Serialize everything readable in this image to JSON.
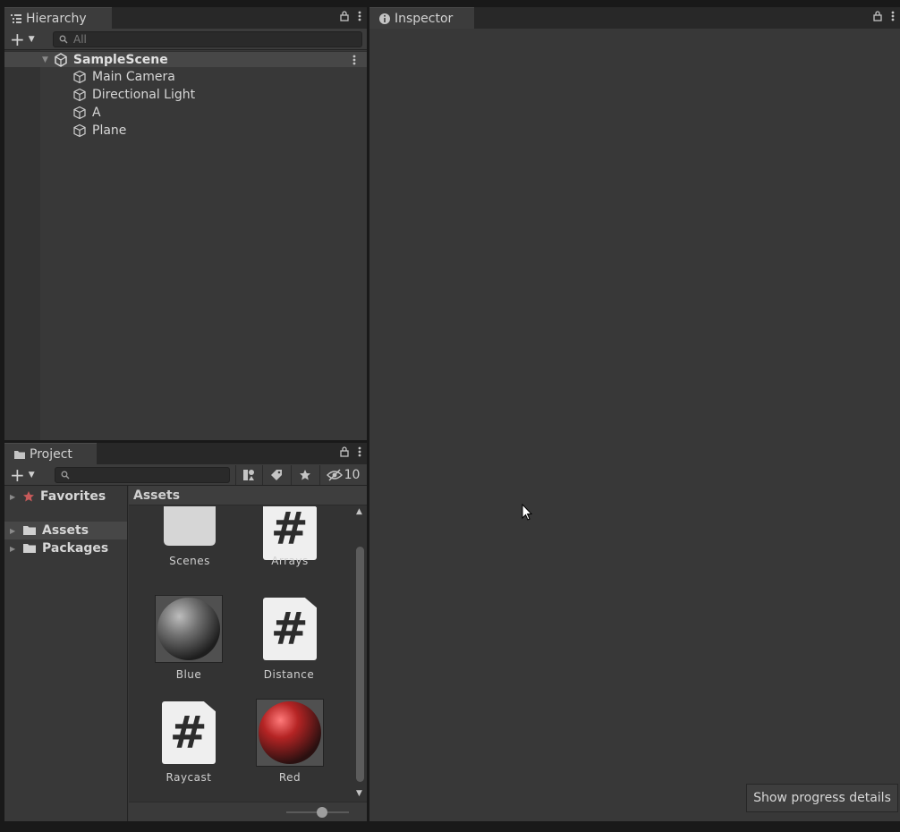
{
  "hierarchy": {
    "tab_label": "Hierarchy",
    "search_placeholder": "All",
    "scene_name": "SampleScene",
    "items": [
      {
        "label": "Main Camera"
      },
      {
        "label": "Directional Light"
      },
      {
        "label": "A"
      },
      {
        "label": "Plane"
      }
    ]
  },
  "inspector": {
    "tab_label": "Inspector"
  },
  "project": {
    "tab_label": "Project",
    "hidden_packages_count": "10",
    "sidebar": {
      "favorites_label": "Favorites",
      "assets_label": "Assets",
      "packages_label": "Packages"
    },
    "breadcrumb": "Assets",
    "assets": [
      {
        "label": "Scenes",
        "kind": "folder-icon"
      },
      {
        "label": "Arrays",
        "kind": "csharp-script-icon"
      },
      {
        "label": "Blue",
        "kind": "material-icon",
        "color": "#7a7a7a"
      },
      {
        "label": "Distance",
        "kind": "csharp-script-icon"
      },
      {
        "label": "Raycast",
        "kind": "csharp-script-icon"
      },
      {
        "label": "Red",
        "kind": "material-icon",
        "color": "#c42a2a"
      }
    ],
    "script_glyph": "#"
  },
  "progress_button_label": "Show progress details",
  "colors": {
    "panel_bg": "#383838",
    "selection_bg": "#474747",
    "app_bg": "#191919"
  }
}
